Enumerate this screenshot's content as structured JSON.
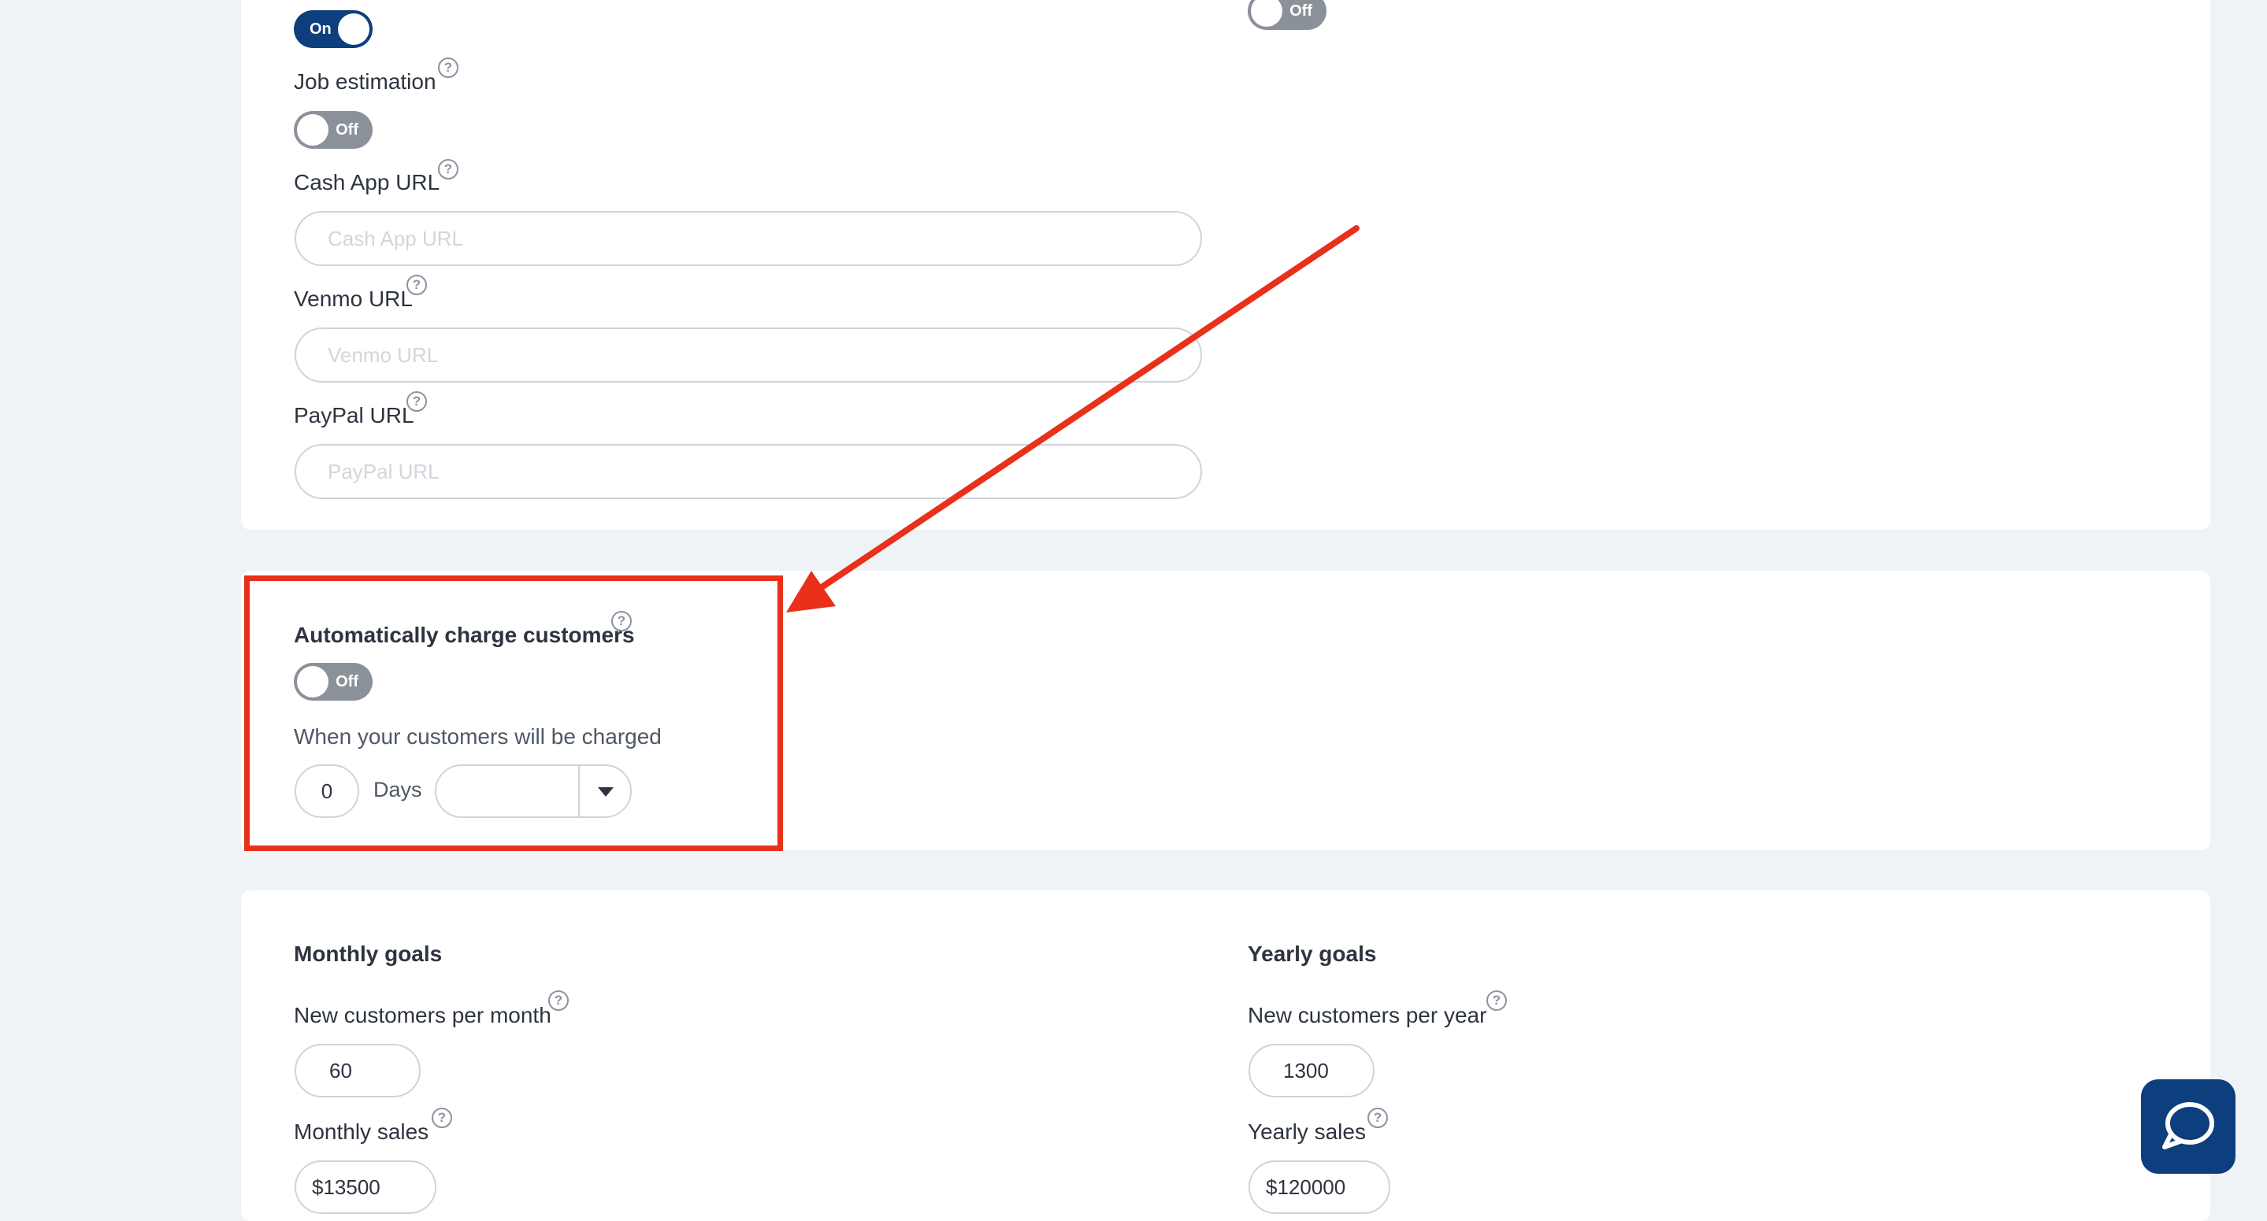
{
  "payment_settings": {
    "top_left_toggle": {
      "state": "On"
    },
    "top_right_toggle": {
      "state": "Off"
    },
    "job_estimation": {
      "label": "Job estimation",
      "toggle": "Off"
    },
    "cash_app": {
      "label": "Cash App URL",
      "placeholder": "Cash App URL",
      "value": ""
    },
    "venmo": {
      "label": "Venmo URL",
      "placeholder": "Venmo URL",
      "value": ""
    },
    "paypal": {
      "label": "PayPal URL",
      "placeholder": "PayPal URL",
      "value": ""
    }
  },
  "auto_charge": {
    "title": "Automatically charge customers",
    "toggle": "Off",
    "when_label": "When your customers will be charged",
    "days_value": "0",
    "days_label": "Days",
    "timing_selected": ""
  },
  "goals": {
    "monthly": {
      "title": "Monthly goals",
      "new_customers_label": "New customers per month",
      "new_customers_value": "60",
      "sales_label": "Monthly sales",
      "sales_currency": "$",
      "sales_value": "13500"
    },
    "yearly": {
      "title": "Yearly goals",
      "new_customers_label": "New customers per year",
      "new_customers_value": "1300",
      "sales_label": "Yearly sales",
      "sales_currency": "$",
      "sales_value": "120000"
    }
  },
  "help_glyph": "?",
  "colors": {
    "toggle_on": "#0d3e7d",
    "toggle_off": "#8a9199",
    "annotation": "#e8301a",
    "chat_button": "#0d3e7d"
  },
  "icons": {
    "help": "question-circle-icon",
    "dropdown": "caret-down-icon",
    "chat": "chat-bubble-icon",
    "annotation": "red-arrow-icon"
  }
}
